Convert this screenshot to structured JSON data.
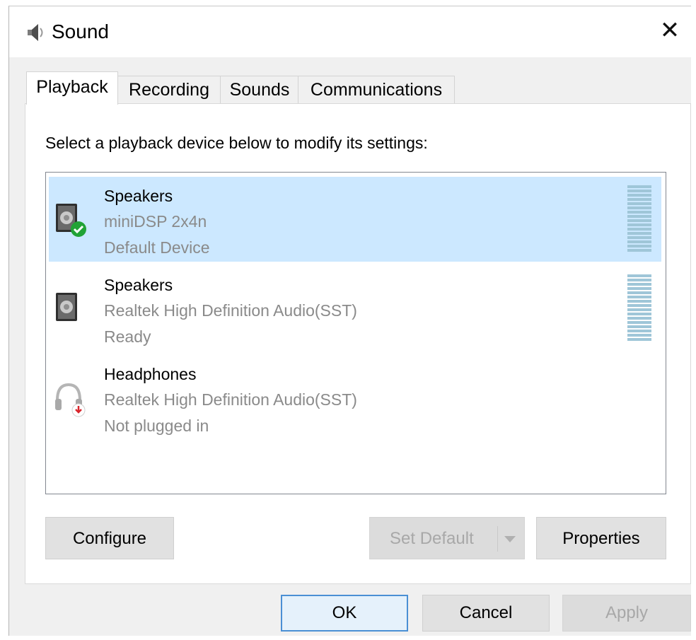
{
  "window": {
    "title": "Sound",
    "close_glyph": "✕"
  },
  "tabs": [
    {
      "label": "Playback",
      "active": true
    },
    {
      "label": "Recording",
      "active": false
    },
    {
      "label": "Sounds",
      "active": false
    },
    {
      "label": "Communications",
      "active": false
    }
  ],
  "playback": {
    "instruction": "Select a playback device below to modify its settings:",
    "devices": [
      {
        "name": "Speakers",
        "description": "miniDSP 2x4n",
        "status": "Default Device",
        "icon": "speaker-icon",
        "badge": "default-check-icon",
        "selected": true
      },
      {
        "name": "Speakers",
        "description": "Realtek High Definition Audio(SST)",
        "status": "Ready",
        "icon": "speaker-icon",
        "badge": null,
        "selected": false
      },
      {
        "name": "Headphones",
        "description": "Realtek High Definition Audio(SST)",
        "status": "Not plugged in",
        "icon": "headphones-icon",
        "badge": "unplugged-icon",
        "selected": false
      }
    ],
    "buttons": {
      "configure": "Configure",
      "set_default": "Set Default",
      "properties": "Properties"
    }
  },
  "footer": {
    "ok": "OK",
    "cancel": "Cancel",
    "apply": "Apply"
  },
  "colors": {
    "selection": "#cce8ff",
    "accent": "#4a8fd4",
    "meter": "#9fc6d8",
    "check": "#21a336",
    "unplugged": "#d9262c"
  }
}
